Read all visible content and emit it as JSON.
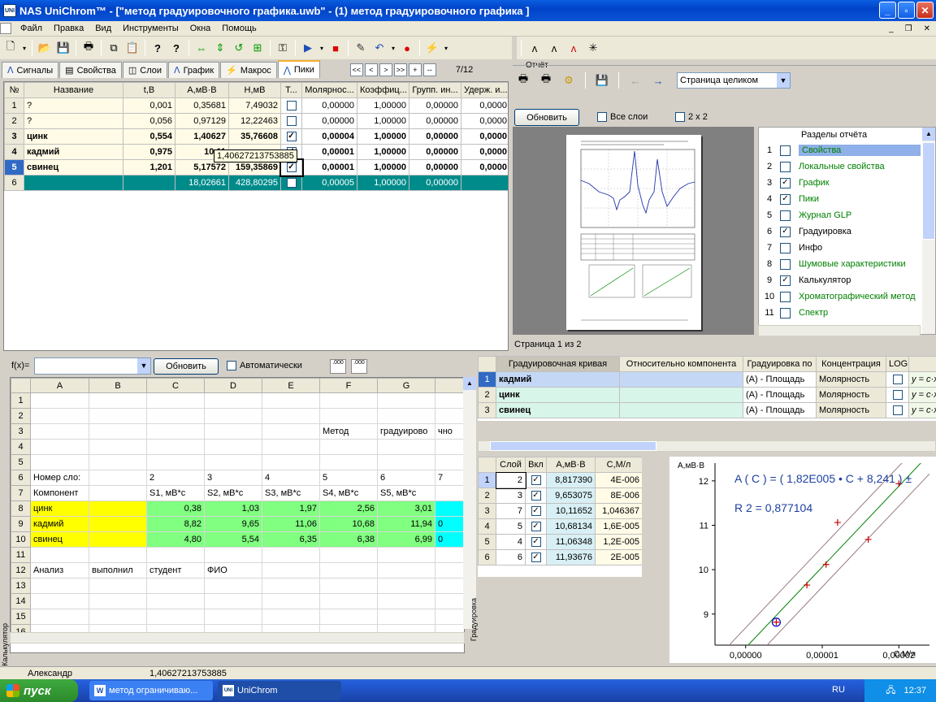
{
  "window": {
    "title": "NAS UniChrom™ - [\"метод градуировочного графика.uwb\" - (1) метод градуировочного графика ]"
  },
  "menu": [
    "Файл",
    "Правка",
    "Вид",
    "Инструменты",
    "Окна",
    "Помощь"
  ],
  "tabs": [
    {
      "label": "Сигналы",
      "icon": "signal-icon"
    },
    {
      "label": "Свойства",
      "icon": "properties-icon"
    },
    {
      "label": "Слои",
      "icon": "layers-icon"
    },
    {
      "label": "График",
      "icon": "chart-icon"
    },
    {
      "label": "Макрос",
      "icon": "macro-icon"
    },
    {
      "label": "Пики",
      "icon": "peaks-icon"
    }
  ],
  "nav": {
    "buttons": [
      "<<",
      "<",
      ">",
      ">>",
      "+",
      "--"
    ],
    "counter": "7/12"
  },
  "peaks": {
    "headers": [
      "№",
      "Название",
      "t,В",
      "A,мВ·В",
      "H,мВ",
      "Т...",
      "Молярнос...",
      "Коэффиц...",
      "Групп. ин...",
      "Удерж. и..."
    ],
    "rows": [
      {
        "n": "1",
        "name": "?",
        "t": "0,001",
        "a": "0,35681",
        "h": "7,49032",
        "checked": false,
        "mol": "0,00000",
        "k": "1,00000",
        "g": "0,00000",
        "u": "0,0000",
        "bold": false
      },
      {
        "n": "2",
        "name": "?",
        "t": "0,056",
        "a": "0,97129",
        "h": "12,22463",
        "checked": false,
        "mol": "0,00000",
        "k": "1,00000",
        "g": "0,00000",
        "u": "0,0000",
        "bold": false
      },
      {
        "n": "3",
        "name": "цинк",
        "t": "0,554",
        "a": "1,40627",
        "h": "35,76608",
        "checked": true,
        "mol": "0,00004",
        "k": "1,00000",
        "g": "0,00000",
        "u": "0,0000",
        "bold": true
      },
      {
        "n": "4",
        "name": "кадмий",
        "t": "0,975",
        "a": "10,11",
        "h": "",
        "checked": true,
        "mol": "0,00001",
        "k": "1,00000",
        "g": "0,00000",
        "u": "0,0000",
        "bold": true
      },
      {
        "n": "5",
        "name": "свинец",
        "t": "1,201",
        "a": "5,17572",
        "h": "159,35869",
        "checked": true,
        "mol": "0,00001",
        "k": "1,00000",
        "g": "0,00000",
        "u": "0,0000",
        "bold": true
      }
    ],
    "total": {
      "n": "6",
      "a": "18,02661",
      "h": "428,80295",
      "mol": "0,00005",
      "k": "1,00000",
      "g": "0,00000"
    },
    "tooltip": "1,40627213753885"
  },
  "report": {
    "label": "Отчёт",
    "page_mode": "Страница целиком",
    "refresh": "Обновить",
    "all_layers": "Все слои",
    "grid_2x2": "2 x 2",
    "page_status": "Страница 1 из 2",
    "sections_header": "Разделы отчёта",
    "sections": [
      {
        "n": "1",
        "label": "Свойства",
        "checked": false,
        "color": "#008000",
        "selected": true
      },
      {
        "n": "2",
        "label": "Локальные свойства",
        "checked": false,
        "color": "#008000"
      },
      {
        "n": "3",
        "label": "График",
        "checked": true,
        "color": "#008000"
      },
      {
        "n": "4",
        "label": "Пики",
        "checked": true,
        "color": "#008000"
      },
      {
        "n": "5",
        "label": "Журнал GLP",
        "checked": false,
        "color": "#008000"
      },
      {
        "n": "6",
        "label": "Градуировка",
        "checked": true,
        "color": "#000000"
      },
      {
        "n": "7",
        "label": "Инфо",
        "checked": false,
        "color": "#000000"
      },
      {
        "n": "8",
        "label": "Шумовые характеристики",
        "checked": false,
        "color": "#008000"
      },
      {
        "n": "9",
        "label": "Калькулятор",
        "checked": true,
        "color": "#000000"
      },
      {
        "n": "10",
        "label": "Хроматографический метод",
        "checked": false,
        "color": "#008000"
      },
      {
        "n": "11",
        "label": "Спектр",
        "checked": false,
        "color": "#008000"
      }
    ]
  },
  "calc": {
    "fx": "f(x)=",
    "refresh": "Обновить",
    "auto": "Автоматически",
    "side_label": "Калькулятор",
    "cols": [
      "A",
      "B",
      "C",
      "D",
      "E",
      "F",
      "G",
      ""
    ],
    "rows": [
      {
        "n": "1",
        "cells": [
          "",
          "",
          "",
          "",
          "",
          "",
          "",
          ""
        ]
      },
      {
        "n": "2",
        "cells": [
          "",
          "",
          "",
          "",
          "",
          "",
          "",
          ""
        ]
      },
      {
        "n": "3",
        "cells": [
          "",
          "",
          "",
          "",
          "",
          "Метод",
          "градуирово",
          "чно"
        ]
      },
      {
        "n": "4",
        "cells": [
          "",
          "",
          "",
          "",
          "",
          "",
          "",
          ""
        ]
      },
      {
        "n": "5",
        "cells": [
          "",
          "",
          "",
          "",
          "",
          "",
          "",
          ""
        ]
      },
      {
        "n": "6",
        "cells": [
          "Номер сло:",
          "",
          "2",
          "3",
          "4",
          "5",
          "6",
          "7"
        ]
      },
      {
        "n": "7",
        "cells": [
          "Компонент",
          "",
          "S1, мВ*с",
          "S2, мВ*с",
          "S3, мВ*с",
          "S4, мВ*с",
          "S5, мВ*с",
          ""
        ]
      },
      {
        "n": "8",
        "cells": [
          "цинк",
          "",
          "0,38",
          "1,03",
          "1,97",
          "2,56",
          "3,01",
          ""
        ],
        "hl": true
      },
      {
        "n": "9",
        "cells": [
          "кадмий",
          "",
          "8,82",
          "9,65",
          "11,06",
          "10,68",
          "11,94",
          "0"
        ],
        "hl": true
      },
      {
        "n": "10",
        "cells": [
          "свинец",
          "",
          "4,80",
          "5,54",
          "6,35",
          "6,38",
          "6,99",
          "0"
        ],
        "hl": true
      },
      {
        "n": "11",
        "cells": [
          "",
          "",
          "",
          "",
          "",
          "",
          "",
          ""
        ]
      },
      {
        "n": "12",
        "cells": [
          "Анализ",
          "выполнил",
          "студент",
          "ФИО",
          "",
          "",
          "",
          ""
        ]
      },
      {
        "n": "13",
        "cells": [
          "",
          "",
          "",
          "",
          "",
          "",
          "",
          ""
        ]
      },
      {
        "n": "14",
        "cells": [
          "",
          "",
          "",
          "",
          "",
          "",
          "",
          ""
        ]
      },
      {
        "n": "15",
        "cells": [
          "",
          "",
          "",
          "",
          "",
          "",
          "",
          ""
        ]
      },
      {
        "n": "16",
        "cells": [
          "",
          "",
          "",
          "",
          "",
          "",
          "",
          ""
        ]
      }
    ]
  },
  "calib": {
    "side_label": "Градуировка",
    "headers": [
      "",
      "Градуировочная кривая",
      "Относительно компонента",
      "Градуировка по",
      "Концентрация",
      "LOG",
      ""
    ],
    "rows": [
      {
        "n": "1",
        "name": "кадмий",
        "by": "(A) - Площадь",
        "conc": "Молярность",
        "formula": "y = c·x"
      },
      {
        "n": "2",
        "name": "цинк",
        "by": "(A) - Площадь",
        "conc": "Молярность",
        "formula": "y = c·x"
      },
      {
        "n": "3",
        "name": "свинец",
        "by": "(A) - Площадь",
        "conc": "Молярность",
        "formula": "y = c·x"
      }
    ],
    "points_headers": [
      "",
      "Слой",
      "Вкл",
      "A,мВ·В",
      "C,М/л"
    ],
    "points": [
      {
        "n": "1",
        "layer": "2",
        "a": "8,817390",
        "c": "4E-006"
      },
      {
        "n": "2",
        "layer": "3",
        "a": "9,653075",
        "c": "8E-006"
      },
      {
        "n": "3",
        "layer": "7",
        "a": "10,11652",
        "c": "1,046367"
      },
      {
        "n": "4",
        "layer": "5",
        "a": "10,68134",
        "c": "1,6E-005"
      },
      {
        "n": "5",
        "layer": "4",
        "a": "11,06348",
        "c": "1,2E-005"
      },
      {
        "n": "6",
        "layer": "6",
        "a": "11,93676",
        "c": "2E-005"
      }
    ]
  },
  "chart_data": {
    "type": "scatter",
    "ylabel": "A,мВ·В",
    "xlabel": "C,М/л",
    "equation": "A ( C ) = ( 1,82E005 • C + 8,241 ) ±",
    "r2": "R 2 = 0,877104",
    "yticks": [
      "9",
      "10",
      "11",
      "12"
    ],
    "xticks": [
      "0,00000",
      "0,00001",
      "0,00002"
    ],
    "xlim": [
      -4e-06,
      2.4e-05
    ],
    "ylim": [
      8.3,
      12.4
    ],
    "points": [
      {
        "x": 4e-06,
        "y": 8.817,
        "selected": true
      },
      {
        "x": 8e-06,
        "y": 9.653
      },
      {
        "x": 1.05e-05,
        "y": 10.117
      },
      {
        "x": 1.6e-05,
        "y": 10.681
      },
      {
        "x": 1.2e-05,
        "y": 11.063
      },
      {
        "x": 2e-05,
        "y": 11.937
      }
    ],
    "line": {
      "slope": 182000,
      "intercept": 8.241,
      "band": 0.45
    },
    "colors": {
      "fit": "#008000",
      "band": "#9a7a7a",
      "points": "#cc0000",
      "selected": "#0000cc"
    }
  },
  "status": {
    "user": "Александр",
    "value": "1,40627213753885"
  },
  "taskbar": {
    "start": "пуск",
    "tasks": [
      {
        "label": "метод ограничиваю...",
        "icon": "word-icon"
      },
      {
        "label": "UniChrom",
        "icon": "unichrom-icon"
      }
    ],
    "lang": "RU",
    "time": "12:37"
  }
}
